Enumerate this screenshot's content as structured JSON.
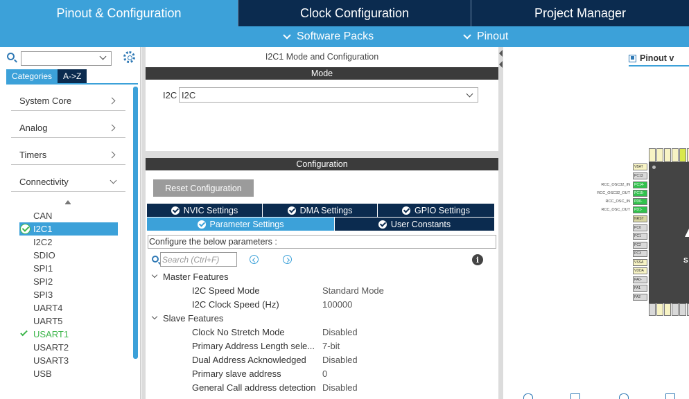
{
  "top_tabs": [
    "Pinout & Configuration",
    "Clock Configuration",
    "Project Manager"
  ],
  "sub_menu": {
    "software_packs": "Software Packs",
    "pinout": "Pinout"
  },
  "left": {
    "cat_tab": "Categories",
    "az_tab": "A->Z",
    "categories": [
      "System Core",
      "Analog",
      "Timers",
      "Connectivity"
    ],
    "peripherals": [
      "CAN",
      "I2C1",
      "I2C2",
      "SDIO",
      "SPI1",
      "SPI2",
      "SPI3",
      "UART4",
      "UART5",
      "USART1",
      "USART2",
      "USART3",
      "USB"
    ]
  },
  "mode_panel": {
    "title": "I2C1 Mode and Configuration",
    "mode_header": "Mode",
    "i2c_label": "I2C",
    "i2c_value": "I2C"
  },
  "config_panel": {
    "header": "Configuration",
    "reset_button": "Reset Configuration",
    "tabs_row1": [
      "NVIC Settings",
      "DMA Settings",
      "GPIO Settings"
    ],
    "tabs_row2": [
      "Parameter Settings",
      "User Constants"
    ],
    "configure_text": "Configure the below parameters :",
    "search_placeholder": "Search (Ctrl+F)",
    "groups": [
      {
        "name": "Master Features",
        "params": [
          {
            "name": "I2C Speed Mode",
            "value": "Standard Mode"
          },
          {
            "name": "I2C Clock Speed (Hz)",
            "value": "100000"
          }
        ]
      },
      {
        "name": "Slave Features",
        "params": [
          {
            "name": "Clock No Stretch Mode",
            "value": "Disabled"
          },
          {
            "name": "Primary Address Length sele...",
            "value": "7-bit"
          },
          {
            "name": "Dual Address Acknowledged",
            "value": "Disabled"
          },
          {
            "name": "Primary slave address",
            "value": "0"
          },
          {
            "name": "General Call address detection",
            "value": "Disabled"
          }
        ]
      }
    ]
  },
  "right": {
    "pinout_tab": "Pinout v",
    "left_pins": [
      "VBAT",
      "PC13",
      "PC14-",
      "PC15-",
      "PD0-",
      "PD1-",
      "NRST",
      "PC0",
      "PC1",
      "PC2",
      "PC3",
      "VSSA",
      "VDDA",
      "PA0-",
      "PA1",
      "PA2"
    ],
    "pin_labels": [
      "RCC_OSC32_IN",
      "RCC_OSC32_OUT",
      "RCC_OSC_IN",
      "RCC_OSC_OUT"
    ],
    "chip_text": "S"
  },
  "colors": {
    "nav_dark": "#0b2b4f",
    "accent_blue": "#3ca1d9",
    "check_green": "#3cb54a"
  }
}
